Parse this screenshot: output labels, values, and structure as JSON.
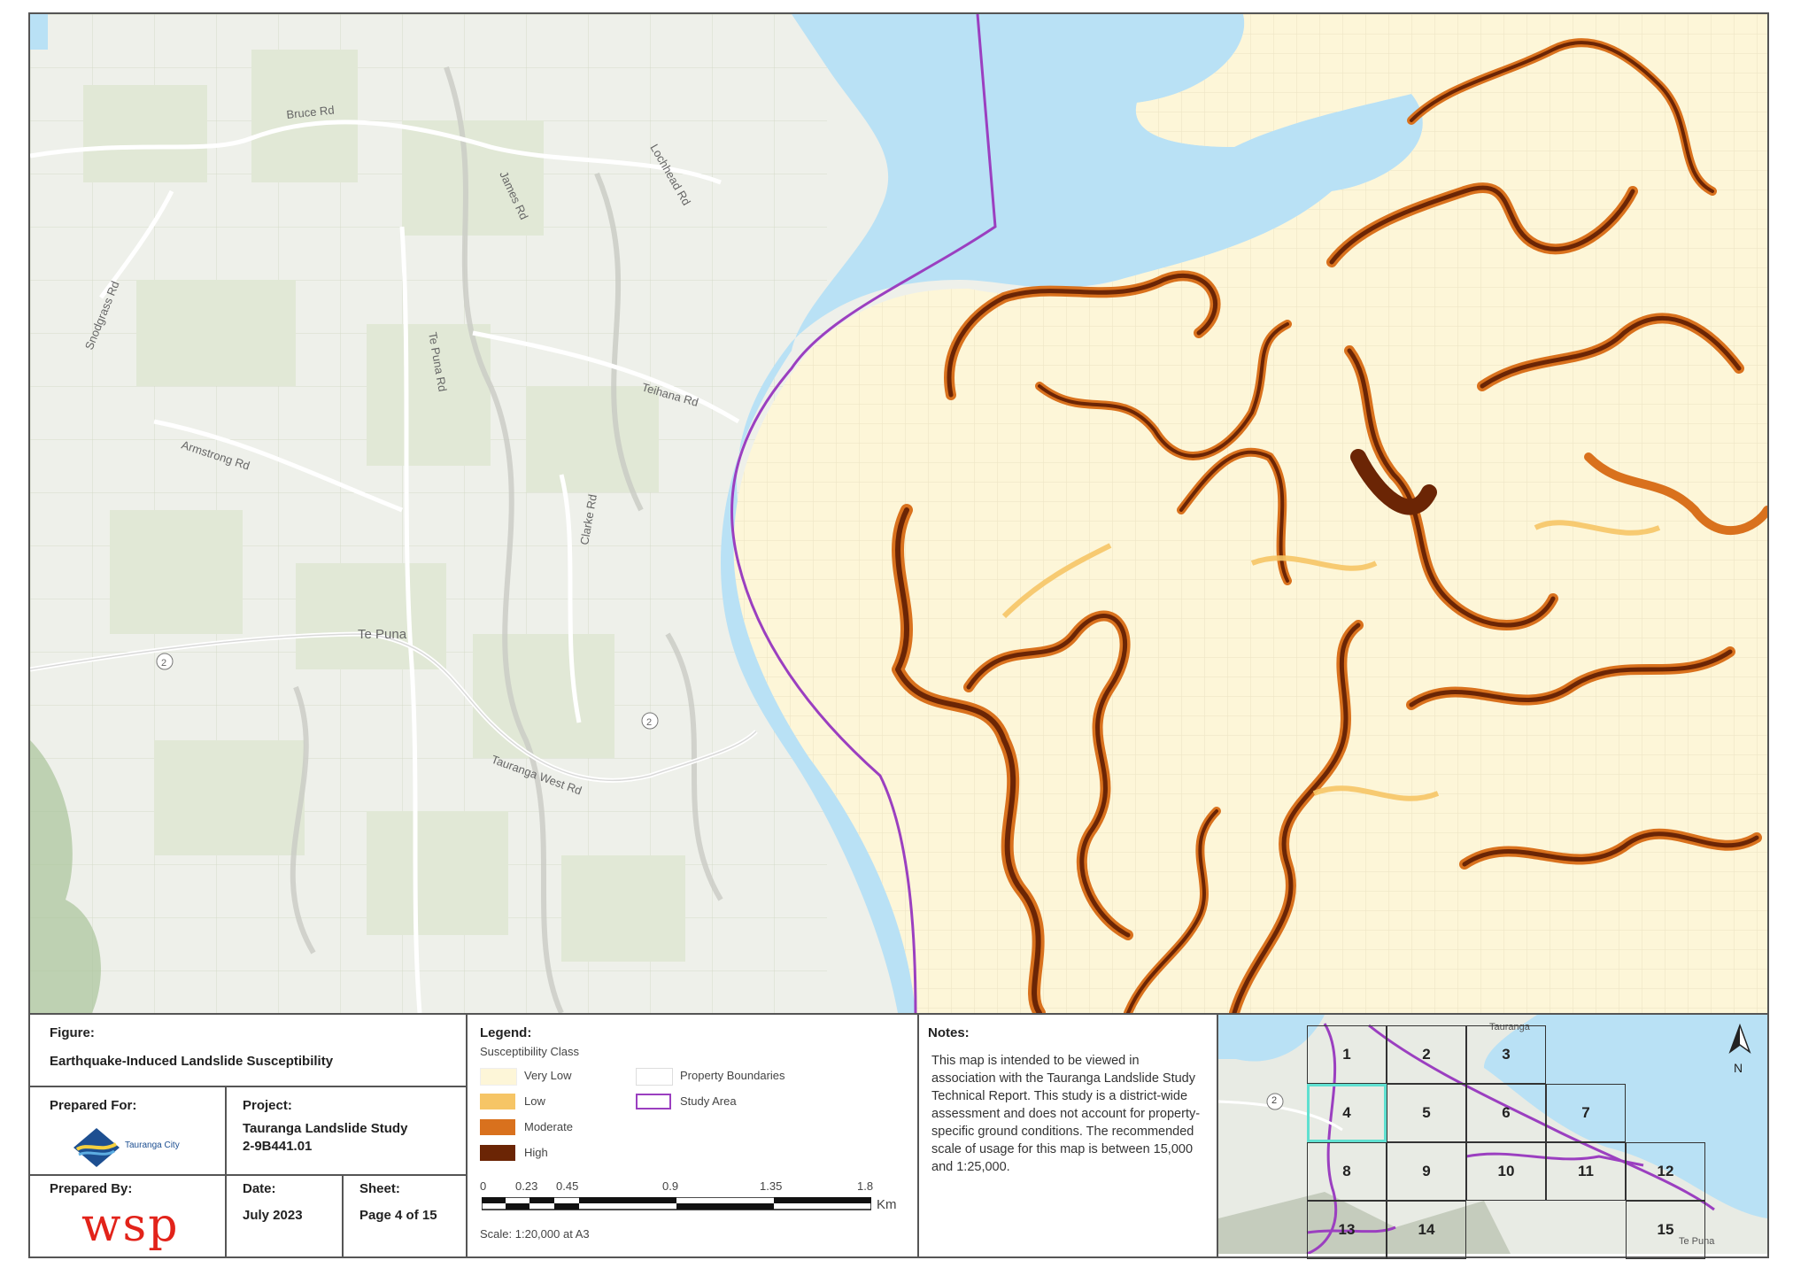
{
  "map": {
    "roads": [
      "Bruce Rd",
      "James Rd",
      "Lochhead Rd",
      "Snodgrass Rd",
      "Te Puna Rd",
      "Armstrong Rd",
      "Teihana Rd",
      "Clarke Rd",
      "Te Puna",
      "Tauranga West Rd",
      "2"
    ]
  },
  "figure": {
    "label": "Figure:",
    "title": "Earthquake-Induced Landslide Susceptibility"
  },
  "prepared_for": {
    "label": "Prepared For:",
    "logo_text": "Tauranga City"
  },
  "project": {
    "label": "Project:",
    "name": "Tauranga Landslide Study",
    "number": "2-9B441.01"
  },
  "prepared_by": {
    "label": "Prepared By:",
    "logo_text": "wsp"
  },
  "date": {
    "label": "Date:",
    "value": "July 2023"
  },
  "sheet": {
    "label": "Sheet:",
    "value": "Page 4 of 15"
  },
  "legend": {
    "title": "Legend:",
    "subtitle": "Susceptibility Class",
    "classes": [
      {
        "label": "Very Low",
        "color": "#fdf6d8"
      },
      {
        "label": "Low",
        "color": "#f6c566"
      },
      {
        "label": "Moderate",
        "color": "#d9711d"
      },
      {
        "label": "High",
        "color": "#6b2505"
      }
    ],
    "other": [
      {
        "label": "Property Boundaries",
        "color": "#dddddd"
      },
      {
        "label": "Study Area",
        "color": "#9b3fc0"
      }
    ]
  },
  "scale": {
    "ticks": [
      "0",
      "0.23",
      "0.45",
      "0.9",
      "1.35",
      "1.8"
    ],
    "unit": "Km",
    "text": "Scale: 1:20,000 at A3"
  },
  "notes": {
    "label": "Notes:",
    "text": "This map is intended to be viewed in association with the Tauranga Landslide Study Technical Report. This study is a district-wide assessment and does not account for property-specific ground conditions. The recommended scale of usage for this map is between 15,000 and 1:25,000."
  },
  "index_map": {
    "tiles": [
      "1",
      "2",
      "3",
      "4",
      "5",
      "6",
      "7",
      "8",
      "9",
      "10",
      "11",
      "12",
      "13",
      "14",
      "15"
    ],
    "current": "4",
    "north": "N",
    "road_shield": "2",
    "places": [
      "Tauranga",
      "Te Puna"
    ]
  }
}
